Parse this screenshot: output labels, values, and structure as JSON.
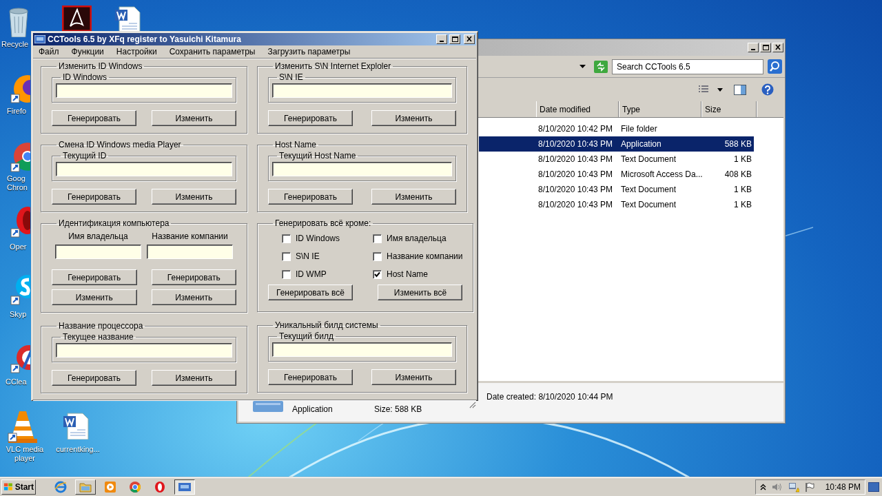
{
  "desktop_icons": [
    {
      "kind": "recycle-bin",
      "label": "Recycle"
    },
    {
      "kind": "pdf"
    },
    {
      "kind": "word"
    },
    {
      "kind": "firefox",
      "label": "Firefo"
    },
    {
      "kind": "chrome",
      "label": "Goog Chron"
    },
    {
      "kind": "opera",
      "label": "Oper"
    },
    {
      "kind": "skype",
      "label": "Skyp"
    },
    {
      "kind": "ccleaner",
      "label": "CClea"
    },
    {
      "kind": "vlc",
      "label": "VLC media player"
    },
    {
      "kind": "word",
      "label": "currentking..."
    }
  ],
  "explorer": {
    "search": {
      "placeholder": "Search CCTools 6.5"
    },
    "columns": [
      "Date modified",
      "Type",
      "Size"
    ],
    "rows": [
      {
        "date": "8/10/2020 10:42 PM",
        "type": "File folder",
        "selected": false
      },
      {
        "date": "8/10/2020 10:43 PM",
        "type": "Application",
        "size": "588 KB",
        "selected": true
      },
      {
        "date": "8/10/2020 10:43 PM",
        "type": "Text Document",
        "size": "1 KB",
        "selected": false
      },
      {
        "date": "8/10/2020 10:43 PM",
        "type": "Microsoft Access Da...",
        "size": "408 KB",
        "selected": false
      },
      {
        "date": "8/10/2020 10:43 PM",
        "type": "Text Document",
        "size": "1 KB",
        "selected": false
      },
      {
        "date": "8/10/2020 10:43 PM",
        "type": "Text Document",
        "size": "1 KB",
        "selected": false
      }
    ],
    "details": {
      "type": "Application",
      "size": "Size: 588 KB",
      "date_created": "Date created: 8/10/2020 10:44 PM"
    }
  },
  "cctools": {
    "title": "CCTools 6.5 by XFq register to Yasuichi Kitamura",
    "menu": [
      "Файл",
      "Функции",
      "Настройки",
      "Сохранить параметры",
      "Загрузить параметры"
    ],
    "left_column": [
      {
        "kind": "field",
        "title": "Изменить ID Windows",
        "field_label": "ID Windows",
        "buttons": [
          "Генерировать",
          "Изменить"
        ]
      },
      {
        "kind": "field",
        "title": "Смена ID Windows media Player",
        "field_label": "Текущий ID",
        "buttons": [
          "Генерировать",
          "Изменить"
        ]
      },
      {
        "kind": "pair",
        "title": "Идентификация компьютера",
        "fields": [
          {
            "label": "Имя владельца"
          },
          {
            "label": "Название компании"
          }
        ],
        "buttons": [
          "Генерировать",
          "Генерировать",
          "Изменить",
          "Изменить"
        ]
      },
      {
        "kind": "field",
        "title": "Название процессора",
        "field_label": "Текущее название",
        "buttons": [
          "Генерировать",
          "Изменить"
        ]
      }
    ],
    "right_column": [
      {
        "kind": "field",
        "title": "Изменить S\\N Internet Exploler",
        "field_label": "S\\N IE",
        "buttons": [
          "Генерировать",
          "Изменить"
        ]
      },
      {
        "kind": "field",
        "title": "Host Name",
        "field_label": "Текущий Host Name",
        "buttons": [
          "Генерировать",
          "Изменить"
        ]
      },
      {
        "kind": "checks",
        "title": "Генерировать всё кроме:",
        "checks": [
          {
            "label": "ID Windows",
            "checked": false
          },
          {
            "label": "Имя владельца",
            "checked": false
          },
          {
            "label": "S\\N IE",
            "checked": false
          },
          {
            "label": "Название компании",
            "checked": false
          },
          {
            "label": "ID WMP",
            "checked": false
          },
          {
            "label": "Host Name",
            "checked": true
          }
        ],
        "buttons": [
          "Генерировать всё",
          "Изменить всё"
        ]
      },
      {
        "kind": "field",
        "title": "Уникальный билд системы",
        "field_label": "Текущий билд",
        "buttons": [
          "Генерировать",
          "Изменить"
        ]
      }
    ]
  },
  "taskbar": {
    "start": "Start",
    "apps": [
      {
        "kind": "ie",
        "open": false,
        "selected": false
      },
      {
        "kind": "folder",
        "open": true,
        "selected": false
      },
      {
        "kind": "media",
        "open": false,
        "selected": false
      },
      {
        "kind": "chrome",
        "open": false,
        "selected": false
      },
      {
        "kind": "opera",
        "open": false,
        "selected": false
      },
      {
        "kind": "cctools",
        "open": true,
        "selected": true
      }
    ],
    "clock": "10:48 PM"
  }
}
